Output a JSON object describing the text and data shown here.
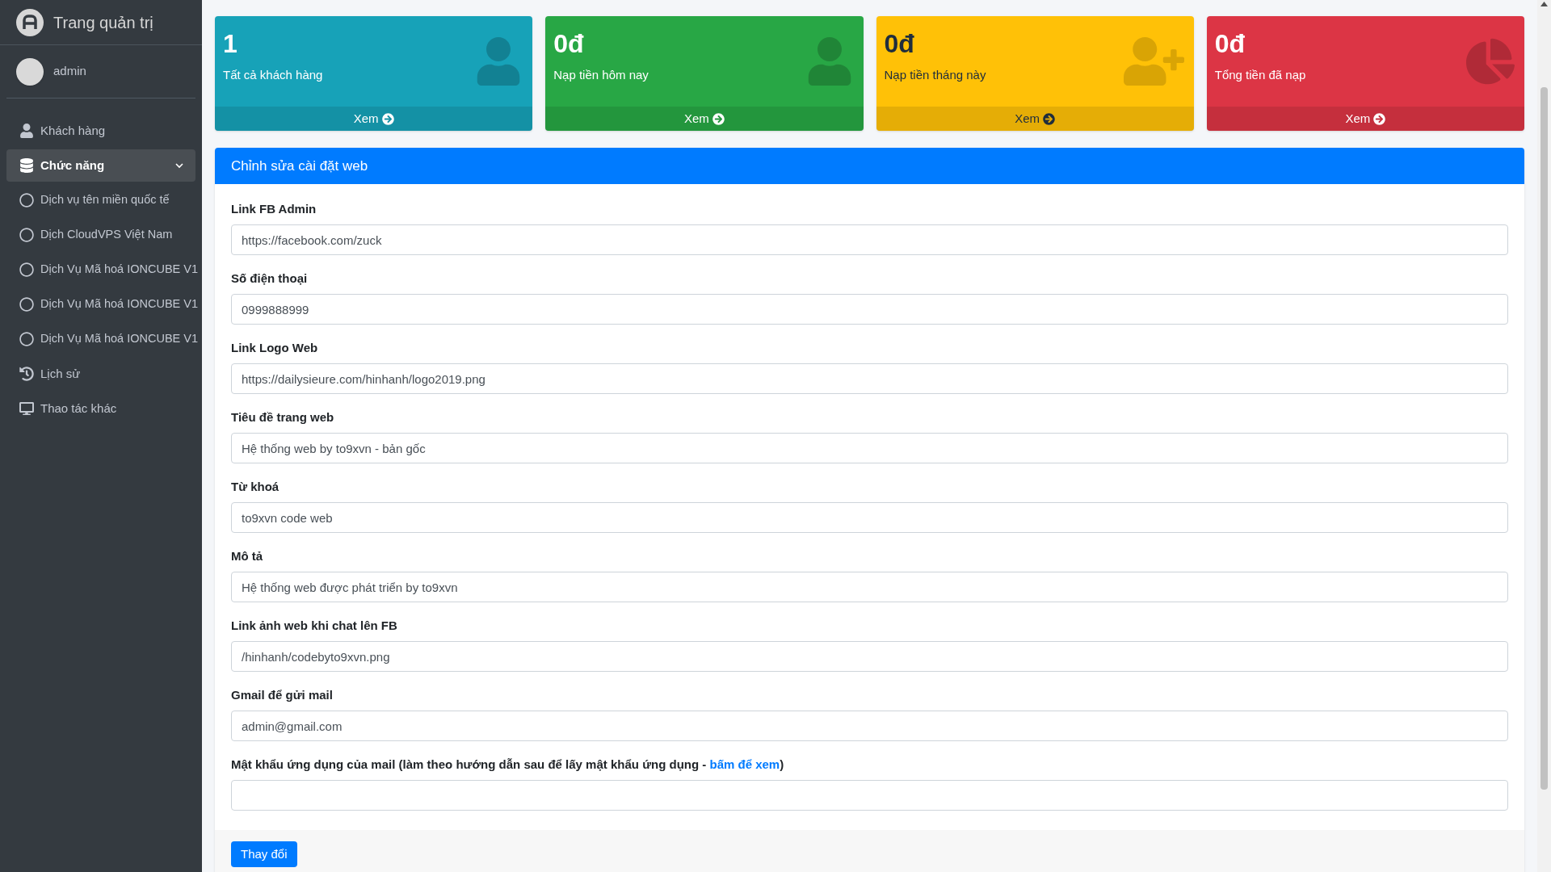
{
  "brand": {
    "title": "Trang quản trị"
  },
  "user": {
    "name": "admin"
  },
  "nav": [
    {
      "label": "Khách hàng",
      "selected": false
    },
    {
      "label": "Chức năng",
      "selected": true,
      "expanded": true,
      "children": [
        {
          "label": "Dịch vụ tên miền quốc tế",
          "selected": false
        },
        {
          "label": "Dịch CloudVPS Việt Nam",
          "selected": false
        },
        {
          "label": "Dịch Vụ Mã hoá IONCUBE V1",
          "selected": false
        },
        {
          "label": "Dịch Vụ Mã hoá IONCUBE V1",
          "selected": false
        },
        {
          "label": "Dịch Vụ Mã hoá IONCUBE V1",
          "selected": false
        }
      ]
    },
    {
      "label": "Lịch sử",
      "selected": false
    },
    {
      "label": "Thao tác khác",
      "selected": false
    }
  ],
  "cards": [
    {
      "value": "1",
      "label": "Tất cả khách hàng",
      "link": "Xem",
      "color": "#17a2b8",
      "kind": "user"
    },
    {
      "value": "0đ",
      "label": "Nạp tiền hôm nay",
      "link": "Xem",
      "color": "#28a745",
      "kind": "user"
    },
    {
      "value": "0đ",
      "label": "Nạp tiền tháng này",
      "link": "Xem",
      "color": "#ffc107",
      "kind": "user-plus"
    },
    {
      "value": "0đ",
      "label": "Tổng tiền đã nạp",
      "link": "Xem",
      "color": "#dc3545",
      "kind": "pie"
    }
  ],
  "form": {
    "title": "Chỉnh sửa cài đặt web",
    "fields": [
      {
        "label": "Link FB Admin",
        "value": "https://facebook.com/zuck"
      },
      {
        "label": "Số điện thoại",
        "value": "0999888999"
      },
      {
        "label": "Link Logo Web",
        "value": "https://dailysieure.com/hinhanh/logo2019.png"
      },
      {
        "label": "Tiêu đề trang web",
        "value": "Hệ thống web by to9xvn - bản gốc"
      },
      {
        "label": "Từ khoá",
        "value": "to9xvn code web"
      },
      {
        "label": "Mô tả",
        "value": "Hệ thống web được phát triển by to9xvn"
      },
      {
        "label": "Link ảnh web khi chat lên FB",
        "value": "/hinhanh/codebyto9xvn.png"
      },
      {
        "label": "Gmail để gửi mail",
        "value": "admin@gmail.com"
      },
      {
        "label": "Mật khẩu ứng dụng của mail (làm theo hướng dẫn sau để lấy mật khẩu ứng dụng - ",
        "link": "bấm để xem",
        "label_end": ")"
      }
    ],
    "submit": "Thay đổi"
  }
}
